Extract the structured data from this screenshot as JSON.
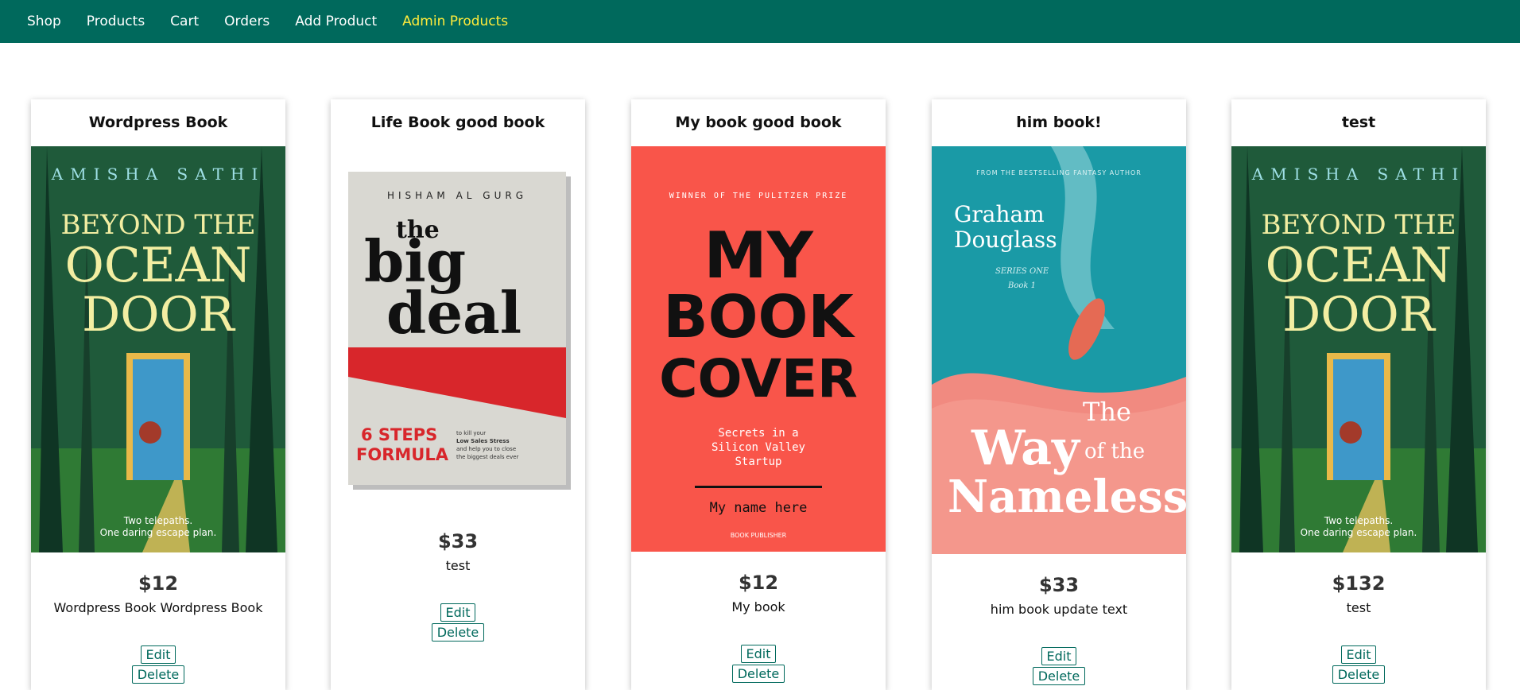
{
  "nav": {
    "items": [
      {
        "label": "Shop"
      },
      {
        "label": "Products"
      },
      {
        "label": "Cart"
      },
      {
        "label": "Orders"
      },
      {
        "label": "Add Product"
      },
      {
        "label": "Admin Products"
      }
    ],
    "active_index": 5,
    "bg_color": "#00695c",
    "active_color": "#ffeb3b"
  },
  "products": [
    {
      "title": "Wordpress Book",
      "price": "$12",
      "description": "Wordpress Book Wordpress Book",
      "edit_label": "Edit",
      "delete_label": "Delete",
      "cover": {
        "author": "AMISHA SATHI",
        "line1": "BEYOND THE",
        "line2": "OCEAN",
        "line3": "DOOR",
        "tagline1": "Two telepaths.",
        "tagline2": "One daring escape plan."
      }
    },
    {
      "title": "Life Book good book",
      "price": "$33",
      "description": "test",
      "edit_label": "Edit",
      "delete_label": "Delete",
      "cover": {
        "author": "HISHAM AL GURG",
        "line1": "the",
        "line2": "big",
        "line3": "deal",
        "sub1": "6 STEPS",
        "sub2": "FORMULA",
        "blurb1": "to kill your",
        "blurb2": "Low Sales Stress",
        "blurb3": "and help you to close",
        "blurb4": "the biggest deals ever"
      }
    },
    {
      "title": "My book good book",
      "price": "$12",
      "description": "My book",
      "edit_label": "Edit",
      "delete_label": "Delete",
      "cover": {
        "award": "WINNER OF THE PULITZER PRIZE",
        "line1": "MY",
        "line2": "BOOK",
        "line3": "COVER",
        "sub1": "Secrets in a",
        "sub2": "Silicon Valley",
        "sub3": "Startup",
        "author": "My name here",
        "publisher": "BOOK PUBLISHER"
      }
    },
    {
      "title": "him book!",
      "price": "$33",
      "description": "him book update text",
      "edit_label": "Edit",
      "delete_label": "Delete",
      "cover": {
        "kicker": "FROM THE BESTSELLING FANTASY AUTHOR",
        "author1": "Graham",
        "author2": "Douglass",
        "series": "SERIES ONE",
        "book": "Book 1",
        "line1": "The",
        "line2": "Way",
        "line3": "of the",
        "line4": "Nameless"
      }
    },
    {
      "title": "test",
      "price": "$132",
      "description": "test",
      "edit_label": "Edit",
      "delete_label": "Delete",
      "cover": {
        "author": "AMISHA SATHI",
        "line1": "BEYOND THE",
        "line2": "OCEAN",
        "line3": "DOOR",
        "tagline1": "Two telepaths.",
        "tagline2": "One daring escape plan."
      }
    }
  ]
}
